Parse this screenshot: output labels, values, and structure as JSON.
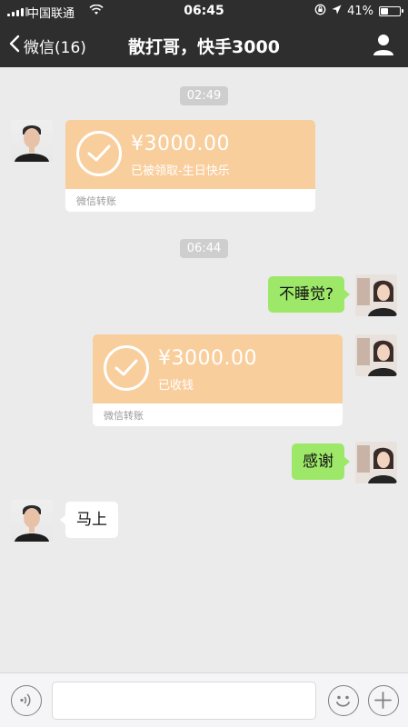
{
  "status_bar": {
    "carrier": "中国联通",
    "time": "06:45",
    "battery_percent": "41%",
    "battery_level": 0.41,
    "icons": [
      "signal-icon",
      "wifi-icon",
      "lock-rotation-icon",
      "location-icon",
      "battery-icon"
    ]
  },
  "nav": {
    "back_label": "微信(16)",
    "title": "散打哥，快手3000",
    "profile_icon": "person-icon"
  },
  "chat": {
    "timestamps": [
      "02:49",
      "06:44"
    ],
    "transfer_1": {
      "amount": "¥3000.00",
      "status": "已被领取-生日快乐",
      "footer": "微信转账"
    },
    "message_1": "不睡觉?",
    "transfer_2": {
      "amount": "¥3000.00",
      "status": "已收钱",
      "footer": "微信转账"
    },
    "message_2": "感谢",
    "message_3": "马上"
  },
  "input_bar": {
    "voice_icon": "voice-icon",
    "emoji_icon": "emoji-icon",
    "plus_icon": "plus-icon"
  },
  "colors": {
    "nav_bg": "#2e2e2e",
    "chat_bg": "#ebebeb",
    "transfer_bg": "#f9ce9d",
    "bubble_green": "#9ee869"
  }
}
